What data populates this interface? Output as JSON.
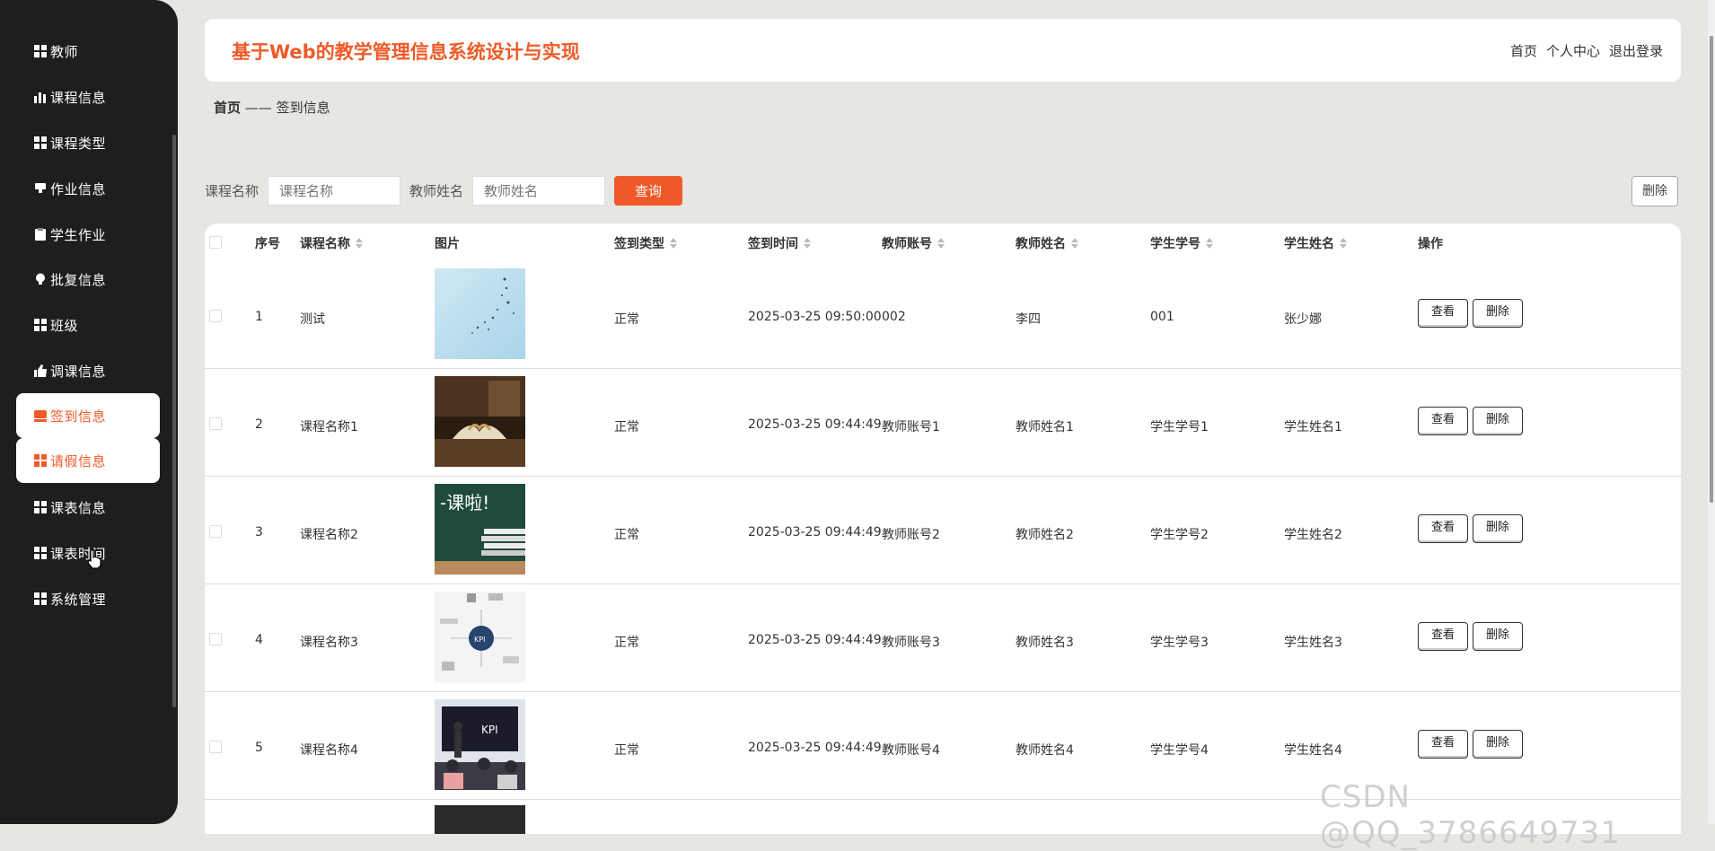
{
  "sidebar": {
    "items": [
      {
        "label": "教师",
        "icon": "grid-icon"
      },
      {
        "label": "课程信息",
        "icon": "bar-chart-icon"
      },
      {
        "label": "课程类型",
        "icon": "grid-icon"
      },
      {
        "label": "作业信息",
        "icon": "cup-icon"
      },
      {
        "label": "学生作业",
        "icon": "clipboard-icon"
      },
      {
        "label": "批复信息",
        "icon": "bulb-icon"
      },
      {
        "label": "班级",
        "icon": "grid-icon"
      },
      {
        "label": "调课信息",
        "icon": "thumb-icon"
      },
      {
        "label": "签到信息",
        "icon": "checkin-icon"
      },
      {
        "label": "请假信息",
        "icon": "grid-icon"
      },
      {
        "label": "课表信息",
        "icon": "grid-icon"
      },
      {
        "label": "课表时间",
        "icon": "grid-icon"
      },
      {
        "label": "系统管理",
        "icon": "grid-icon"
      }
    ]
  },
  "header": {
    "title": "基于Web的教学管理信息系统设计与实现",
    "links": [
      "首页",
      "个人中心",
      "退出登录"
    ]
  },
  "breadcrumb": {
    "home": "首页",
    "sep": "——",
    "current": "签到信息"
  },
  "search": {
    "course_label": "课程名称",
    "course_placeholder": "课程名称",
    "teacher_label": "教师姓名",
    "teacher_placeholder": "教师姓名",
    "query_button": "查询",
    "delete_button": "删除"
  },
  "table": {
    "headers": [
      "序号",
      "课程名称",
      "图片",
      "签到类型",
      "签到时间",
      "教师账号",
      "教师姓名",
      "学生学号",
      "学生姓名",
      "操作"
    ],
    "rows": [
      {
        "no": "1",
        "course": "测试",
        "type": "正常",
        "time": "2025-03-25 09:50:00",
        "t_acc": "002",
        "t_name": "李四",
        "s_no": "001",
        "s_name": "张少娜"
      },
      {
        "no": "2",
        "course": "课程名称1",
        "type": "正常",
        "time": "2025-03-25 09:44:49",
        "t_acc": "教师账号1",
        "t_name": "教师姓名1",
        "s_no": "学生学号1",
        "s_name": "学生姓名1"
      },
      {
        "no": "3",
        "course": "课程名称2",
        "type": "正常",
        "time": "2025-03-25 09:44:49",
        "t_acc": "教师账号2",
        "t_name": "教师姓名2",
        "s_no": "学生学号2",
        "s_name": "学生姓名2"
      },
      {
        "no": "4",
        "course": "课程名称3",
        "type": "正常",
        "time": "2025-03-25 09:44:49",
        "t_acc": "教师账号3",
        "t_name": "教师姓名3",
        "s_no": "学生学号3",
        "s_name": "学生姓名3"
      },
      {
        "no": "5",
        "course": "课程名称4",
        "type": "正常",
        "time": "2025-03-25 09:44:49",
        "t_acc": "教师账号4",
        "t_name": "教师姓名4",
        "s_no": "学生学号4",
        "s_name": "学生姓名4"
      }
    ],
    "view_label": "查看",
    "delete_label": "删除"
  },
  "watermark": "CSDN @QQ_3786649731",
  "colors": {
    "accent": "#f05a28",
    "sidebar": "#1e1e1e"
  }
}
